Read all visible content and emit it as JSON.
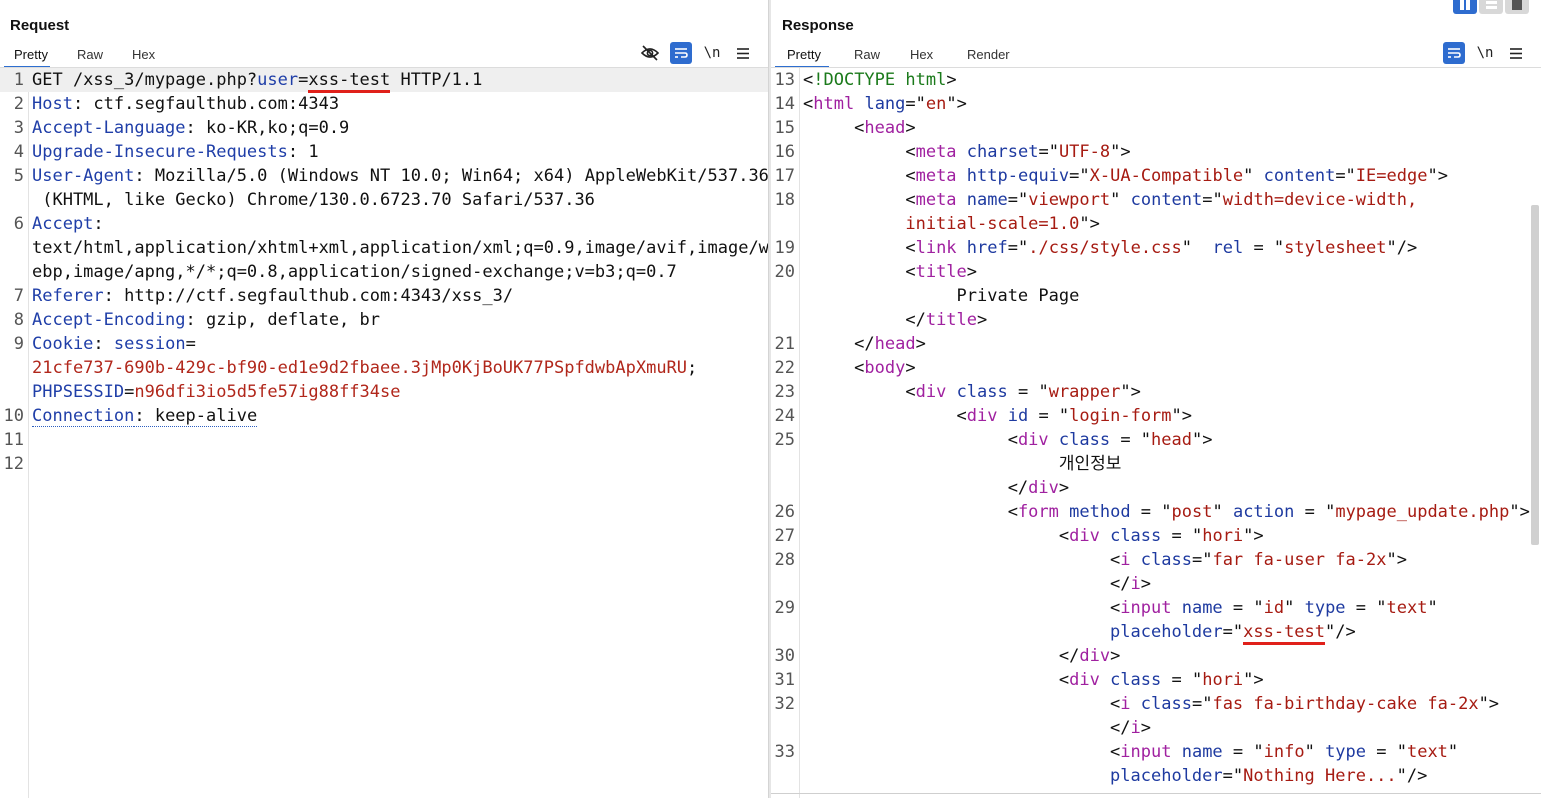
{
  "request": {
    "title": "Request",
    "tabs": [
      "Pretty",
      "Raw",
      "Hex"
    ],
    "active_tab": "Pretty",
    "newline_toggle": "\\n"
  },
  "response": {
    "title": "Response",
    "tabs": [
      "Pretty",
      "Raw",
      "Hex",
      "Render"
    ],
    "active_tab": "Pretty",
    "newline_toggle": "\\n"
  },
  "colors": {
    "accent": "#2e6ccf",
    "highlight_underline": "#e0201a",
    "key": "#1f3ea8",
    "value": "#b1271b",
    "tag": "#a021a0"
  },
  "request_lines": [
    {
      "n": "1",
      "parts": [
        [
          "",
          "GET /xss_3/mypage.php?"
        ],
        [
          "k",
          "user"
        ],
        [
          "",
          "="
        ],
        [
          "ul",
          "xss-test"
        ],
        [
          "",
          " HTTP/1.1"
        ]
      ]
    },
    {
      "n": "2",
      "parts": [
        [
          "k",
          "Host"
        ],
        [
          "",
          ": ctf.segfaulthub.com:4343"
        ]
      ]
    },
    {
      "n": "3",
      "parts": [
        [
          "k",
          "Accept-Language"
        ],
        [
          "",
          ": ko-KR,ko;q=0.9"
        ]
      ]
    },
    {
      "n": "4",
      "parts": [
        [
          "k",
          "Upgrade-Insecure-Requests"
        ],
        [
          "",
          ": 1"
        ]
      ]
    },
    {
      "n": "5",
      "parts": [
        [
          "k",
          "User-Agent"
        ],
        [
          "",
          ": Mozilla/5.0 (Windows NT 10.0; Win64; x64) AppleWebKit/537.36"
        ]
      ]
    },
    {
      "n": "",
      "parts": [
        [
          "",
          " (KHTML, like Gecko) Chrome/130.0.6723.70 Safari/537.36"
        ]
      ]
    },
    {
      "n": "6",
      "parts": [
        [
          "k",
          "Accept"
        ],
        [
          "",
          ":"
        ]
      ]
    },
    {
      "n": "",
      "parts": [
        [
          "",
          "text/html,application/xhtml+xml,application/xml;q=0.9,image/avif,image/w"
        ]
      ]
    },
    {
      "n": "",
      "parts": [
        [
          "",
          "ebp,image/apng,*/*;q=0.8,application/signed-exchange;v=b3;q=0.7"
        ]
      ]
    },
    {
      "n": "7",
      "parts": [
        [
          "k",
          "Referer"
        ],
        [
          "",
          ": http://ctf.segfaulthub.com:4343/xss_3/"
        ]
      ]
    },
    {
      "n": "8",
      "parts": [
        [
          "k",
          "Accept-Encoding"
        ],
        [
          "",
          ": gzip, deflate, br"
        ]
      ]
    },
    {
      "n": "9",
      "parts": [
        [
          "k",
          "Cookie"
        ],
        [
          "",
          ": "
        ],
        [
          "k",
          "session"
        ],
        [
          "",
          "="
        ]
      ]
    },
    {
      "n": "",
      "parts": [
        [
          "v",
          "21cfe737-690b-429c-bf90-ed1e9d2fbaee.3jMp0KjBoUK77PSpfdwbApXmuRU"
        ],
        [
          "",
          ";"
        ]
      ]
    },
    {
      "n": "",
      "parts": [
        [
          "k",
          "PHPSESSID"
        ],
        [
          "",
          "="
        ],
        [
          "v",
          "n96dfi3io5d5fe57ig88ff34se"
        ]
      ]
    },
    {
      "n": "10",
      "parts": [
        [
          "kdot",
          "Connection"
        ],
        [
          "dot",
          ": keep-alive"
        ]
      ]
    },
    {
      "n": "11",
      "parts": [
        [
          "",
          ""
        ]
      ]
    },
    {
      "n": "12",
      "parts": [
        [
          "",
          ""
        ]
      ]
    }
  ],
  "response_lines": [
    {
      "n": "13",
      "parts": [
        [
          "",
          "<"
        ],
        [
          "d",
          "!DOCTYPE html"
        ],
        [
          "",
          ">"
        ]
      ]
    },
    {
      "n": "14",
      "parts": [
        [
          "",
          "<"
        ],
        [
          "t",
          "html"
        ],
        [
          "",
          " "
        ],
        [
          "a",
          "lang"
        ],
        [
          "",
          "=\""
        ],
        [
          "s",
          "en"
        ],
        [
          "",
          "\">"
        ]
      ]
    },
    {
      "n": "15",
      "parts": [
        [
          "",
          "     <"
        ],
        [
          "t",
          "head"
        ],
        [
          "",
          ">"
        ]
      ]
    },
    {
      "n": "16",
      "parts": [
        [
          "",
          "          <"
        ],
        [
          "t",
          "meta"
        ],
        [
          "",
          " "
        ],
        [
          "a",
          "charset"
        ],
        [
          "",
          "=\""
        ],
        [
          "s",
          "UTF-8"
        ],
        [
          "",
          "\">"
        ]
      ]
    },
    {
      "n": "17",
      "parts": [
        [
          "",
          "          <"
        ],
        [
          "t",
          "meta"
        ],
        [
          "",
          " "
        ],
        [
          "a",
          "http-equiv"
        ],
        [
          "",
          "=\""
        ],
        [
          "s",
          "X-UA-Compatible"
        ],
        [
          "",
          "\" "
        ],
        [
          "a",
          "content"
        ],
        [
          "",
          "=\""
        ],
        [
          "s",
          "IE=edge"
        ],
        [
          "",
          "\">"
        ]
      ]
    },
    {
      "n": "18",
      "parts": [
        [
          "",
          "          <"
        ],
        [
          "t",
          "meta"
        ],
        [
          "",
          " "
        ],
        [
          "a",
          "name"
        ],
        [
          "",
          "=\""
        ],
        [
          "s",
          "viewport"
        ],
        [
          "",
          "\" "
        ],
        [
          "a",
          "content"
        ],
        [
          "",
          "=\""
        ],
        [
          "s",
          "width=device-width,"
        ]
      ]
    },
    {
      "n": "",
      "parts": [
        [
          "s",
          "          initial-scale=1.0"
        ],
        [
          "",
          "\">"
        ]
      ]
    },
    {
      "n": "19",
      "parts": [
        [
          "",
          "          <"
        ],
        [
          "t",
          "link"
        ],
        [
          "",
          " "
        ],
        [
          "a",
          "href"
        ],
        [
          "",
          "=\""
        ],
        [
          "s",
          "./css/style.css"
        ],
        [
          "",
          "\"  "
        ],
        [
          "a",
          "rel"
        ],
        [
          "",
          " = \""
        ],
        [
          "s",
          "stylesheet"
        ],
        [
          "",
          "\"/>"
        ]
      ]
    },
    {
      "n": "20",
      "parts": [
        [
          "",
          "          <"
        ],
        [
          "t",
          "title"
        ],
        [
          "",
          ">"
        ]
      ]
    },
    {
      "n": "",
      "parts": [
        [
          "",
          "               Private Page"
        ]
      ]
    },
    {
      "n": "",
      "parts": [
        [
          "",
          "          </"
        ],
        [
          "t",
          "title"
        ],
        [
          "",
          ">"
        ]
      ]
    },
    {
      "n": "21",
      "parts": [
        [
          "",
          "     </"
        ],
        [
          "t",
          "head"
        ],
        [
          "",
          ">"
        ]
      ]
    },
    {
      "n": "22",
      "parts": [
        [
          "",
          "     <"
        ],
        [
          "t",
          "body"
        ],
        [
          "",
          ">"
        ]
      ]
    },
    {
      "n": "23",
      "parts": [
        [
          "",
          "          <"
        ],
        [
          "t",
          "div"
        ],
        [
          "",
          " "
        ],
        [
          "a",
          "class"
        ],
        [
          "",
          " = \""
        ],
        [
          "s",
          "wrapper"
        ],
        [
          "",
          "\">"
        ]
      ]
    },
    {
      "n": "24",
      "parts": [
        [
          "",
          "               <"
        ],
        [
          "t",
          "div"
        ],
        [
          "",
          " "
        ],
        [
          "a",
          "id"
        ],
        [
          "",
          " = \""
        ],
        [
          "s",
          "login-form"
        ],
        [
          "",
          "\">"
        ]
      ]
    },
    {
      "n": "25",
      "parts": [
        [
          "",
          "                    <"
        ],
        [
          "t",
          "div"
        ],
        [
          "",
          " "
        ],
        [
          "a",
          "class"
        ],
        [
          "",
          " = \""
        ],
        [
          "s",
          "head"
        ],
        [
          "",
          "\">"
        ]
      ]
    },
    {
      "n": "",
      "parts": [
        [
          "",
          "                         개인정보"
        ]
      ]
    },
    {
      "n": "",
      "parts": [
        [
          "",
          "                    </"
        ],
        [
          "t",
          "div"
        ],
        [
          "",
          ">"
        ]
      ]
    },
    {
      "n": "26",
      "parts": [
        [
          "",
          "                    <"
        ],
        [
          "t",
          "form"
        ],
        [
          "",
          " "
        ],
        [
          "a",
          "method"
        ],
        [
          "",
          " = \""
        ],
        [
          "s",
          "post"
        ],
        [
          "",
          "\" "
        ],
        [
          "a",
          "action"
        ],
        [
          "",
          " = \""
        ],
        [
          "s",
          "mypage_update.php"
        ],
        [
          "",
          "\">"
        ]
      ]
    },
    {
      "n": "27",
      "parts": [
        [
          "",
          "                         <"
        ],
        [
          "t",
          "div"
        ],
        [
          "",
          " "
        ],
        [
          "a",
          "class"
        ],
        [
          "",
          " = \""
        ],
        [
          "s",
          "hori"
        ],
        [
          "",
          "\">"
        ]
      ]
    },
    {
      "n": "28",
      "parts": [
        [
          "",
          "                              <"
        ],
        [
          "t",
          "i"
        ],
        [
          "",
          " "
        ],
        [
          "a",
          "class"
        ],
        [
          "",
          "=\""
        ],
        [
          "s",
          "far fa-user fa-2x"
        ],
        [
          "",
          "\">"
        ]
      ]
    },
    {
      "n": "",
      "parts": [
        [
          "",
          "                              </"
        ],
        [
          "t",
          "i"
        ],
        [
          "",
          ">"
        ]
      ]
    },
    {
      "n": "29",
      "parts": [
        [
          "",
          "                              <"
        ],
        [
          "t",
          "input"
        ],
        [
          "",
          " "
        ],
        [
          "a",
          "name"
        ],
        [
          "",
          " = \""
        ],
        [
          "s",
          "id"
        ],
        [
          "",
          "\" "
        ],
        [
          "a",
          "type"
        ],
        [
          "",
          " = \""
        ],
        [
          "s",
          "text"
        ],
        [
          "",
          "\""
        ]
      ]
    },
    {
      "n": "",
      "parts": [
        [
          "a",
          "                              placeholder"
        ],
        [
          "",
          "=\""
        ],
        [
          "sul",
          "xss-test"
        ],
        [
          "",
          "\"/>"
        ]
      ]
    },
    {
      "n": "30",
      "parts": [
        [
          "",
          "                         </"
        ],
        [
          "t",
          "div"
        ],
        [
          "",
          ">"
        ]
      ]
    },
    {
      "n": "31",
      "parts": [
        [
          "",
          "                         <"
        ],
        [
          "t",
          "div"
        ],
        [
          "",
          " "
        ],
        [
          "a",
          "class"
        ],
        [
          "",
          " = \""
        ],
        [
          "s",
          "hori"
        ],
        [
          "",
          "\">"
        ]
      ]
    },
    {
      "n": "32",
      "parts": [
        [
          "",
          "                              <"
        ],
        [
          "t",
          "i"
        ],
        [
          "",
          " "
        ],
        [
          "a",
          "class"
        ],
        [
          "",
          "=\""
        ],
        [
          "s",
          "fas fa-birthday-cake fa-2x"
        ],
        [
          "",
          "\">"
        ]
      ]
    },
    {
      "n": "",
      "parts": [
        [
          "",
          "                              </"
        ],
        [
          "t",
          "i"
        ],
        [
          "",
          ">"
        ]
      ]
    },
    {
      "n": "33",
      "parts": [
        [
          "",
          "                              <"
        ],
        [
          "t",
          "input"
        ],
        [
          "",
          " "
        ],
        [
          "a",
          "name"
        ],
        [
          "",
          " = \""
        ],
        [
          "s",
          "info"
        ],
        [
          "",
          "\" "
        ],
        [
          "a",
          "type"
        ],
        [
          "",
          " = \""
        ],
        [
          "s",
          "text"
        ],
        [
          "",
          "\""
        ]
      ]
    },
    {
      "n": "",
      "parts": [
        [
          "a",
          "                              placeholder"
        ],
        [
          "",
          "=\""
        ],
        [
          "s",
          "Nothing Here..."
        ],
        [
          "",
          "\"/>"
        ]
      ]
    }
  ]
}
